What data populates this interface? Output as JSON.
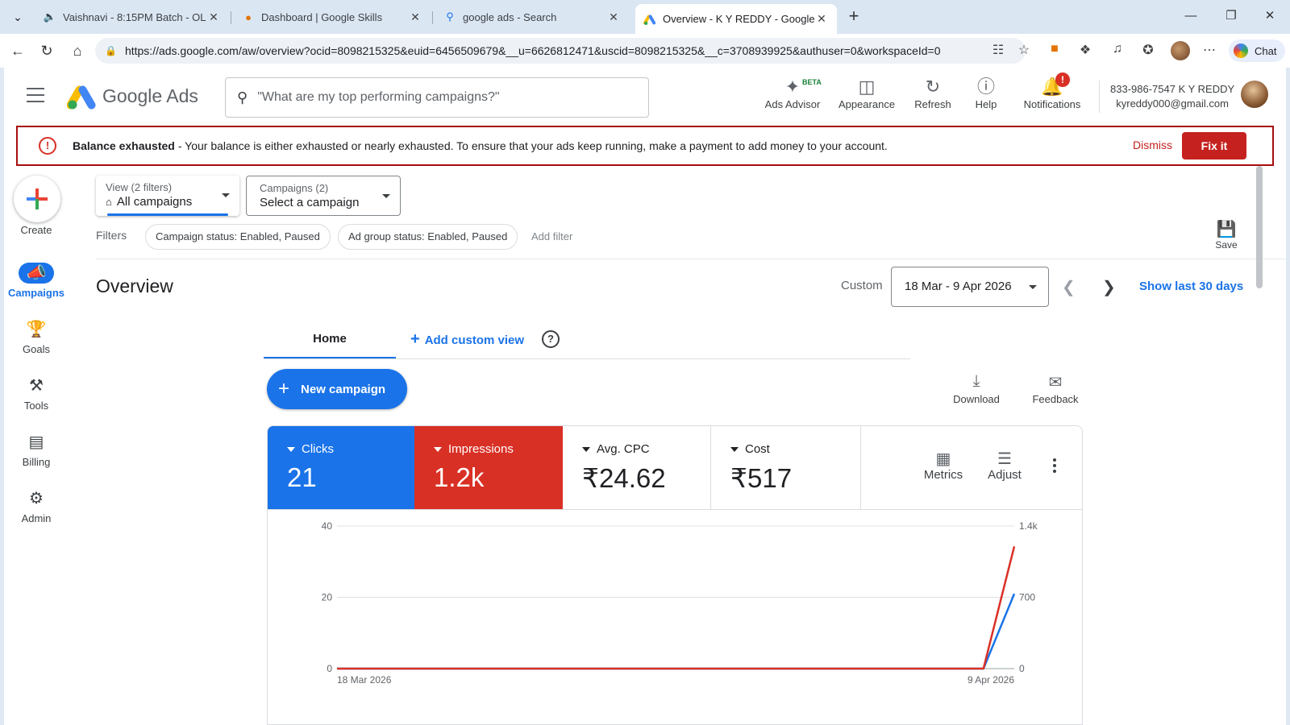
{
  "browser": {
    "tabs": [
      {
        "label": "Vaishnavi - 8:15PM Batch - OL",
        "icon": "speaker-icon"
      },
      {
        "label": "Dashboard | Google Skills",
        "icon": "google-skills-icon"
      },
      {
        "label": "google ads - Search",
        "icon": "search-icon"
      },
      {
        "label": "Overview - K Y REDDY - Google Ads",
        "icon": "google-ads-icon"
      }
    ],
    "url": "https://ads.google.com/aw/overview?ocid=8098215325&euid=6456509679&__u=6626812471&uscid=8098215325&__c=3708939925&authuser=0&workspaceId=0",
    "chat_label": "Chat"
  },
  "header": {
    "brand": "Google Ads",
    "search_placeholder": "\"What are my top performing campaigns?\"",
    "tools": {
      "ads_advisor": "Ads Advisor",
      "beta": "BETA",
      "appearance": "Appearance",
      "refresh": "Refresh",
      "help": "Help",
      "notifications": "Notifications",
      "notification_badge": "!"
    },
    "account": {
      "line1": "833-986-7547 K Y REDDY",
      "line2": "kyreddy000@gmail.com"
    }
  },
  "alert": {
    "title": "Balance exhausted",
    "text": " - Your balance is either exhausted or nearly exhausted. To ensure that your ads keep running, make a payment to add money to your account.",
    "dismiss": "Dismiss",
    "fix": "Fix it"
  },
  "rail": {
    "create": "Create",
    "items": [
      {
        "label": "Campaigns",
        "icon": "megaphone-icon"
      },
      {
        "label": "Goals",
        "icon": "trophy-icon"
      },
      {
        "label": "Tools",
        "icon": "tools-icon"
      },
      {
        "label": "Billing",
        "icon": "credit-card-icon"
      },
      {
        "label": "Admin",
        "icon": "gear-icon"
      }
    ]
  },
  "filters": {
    "view_label": "View (2 filters)",
    "view_value": "All campaigns",
    "campaigns_label": "Campaigns (2)",
    "campaigns_value": "Select a campaign",
    "filters_label": "Filters",
    "chips": [
      "Campaign status: Enabled, Paused",
      "Ad group status: Enabled, Paused"
    ],
    "add_filter": "Add filter",
    "save": "Save"
  },
  "overview": {
    "title": "Overview",
    "custom_label": "Custom",
    "date_range": "18 Mar - 9 Apr 2026",
    "show_last": "Show last 30 days",
    "tabs": {
      "home": "Home",
      "add_view": "Add custom view"
    },
    "new_campaign": "New campaign",
    "download": "Download",
    "feedback": "Feedback"
  },
  "metrics": [
    {
      "name": "Clicks",
      "value": "21",
      "color": "#1a73e8"
    },
    {
      "name": "Impressions",
      "value": "1.2k",
      "color": "#d93025"
    },
    {
      "name": "Avg. CPC",
      "value": "₹24.62"
    },
    {
      "name": "Cost",
      "value": "₹517"
    }
  ],
  "card_tools": {
    "metrics": "Metrics",
    "adjust": "Adjust"
  },
  "chart_data": {
    "type": "line",
    "x": [
      "18 Mar 2026",
      "19 Mar 2026",
      "20 Mar 2026",
      "21 Mar 2026",
      "22 Mar 2026",
      "23 Mar 2026",
      "24 Mar 2026",
      "25 Mar 2026",
      "26 Mar 2026",
      "27 Mar 2026",
      "28 Mar 2026",
      "29 Mar 2026",
      "30 Mar 2026",
      "31 Mar 2026",
      "1 Apr 2026",
      "2 Apr 2026",
      "3 Apr 2026",
      "4 Apr 2026",
      "5 Apr 2026",
      "6 Apr 2026",
      "7 Apr 2026",
      "8 Apr 2026",
      "9 Apr 2026"
    ],
    "x_tick_labels": [
      "18 Mar 2026",
      "9 Apr 2026"
    ],
    "series": [
      {
        "name": "Clicks",
        "axis": "left",
        "color": "#1a73e8",
        "values": [
          0,
          0,
          0,
          0,
          0,
          0,
          0,
          0,
          0,
          0,
          0,
          0,
          0,
          0,
          0,
          0,
          0,
          0,
          0,
          0,
          0,
          0,
          21
        ]
      },
      {
        "name": "Impressions",
        "axis": "right",
        "color": "#d93025",
        "values": [
          0,
          0,
          0,
          0,
          0,
          0,
          0,
          0,
          0,
          0,
          0,
          0,
          0,
          0,
          0,
          0,
          0,
          0,
          0,
          0,
          0,
          0,
          1200
        ]
      }
    ],
    "left_axis": {
      "ticks": [
        "0",
        "20",
        "40"
      ],
      "ylim": [
        0,
        40
      ]
    },
    "right_axis": {
      "ticks": [
        "0",
        "700",
        "1.4k"
      ],
      "ylim": [
        0,
        1400
      ]
    },
    "grid": true
  }
}
